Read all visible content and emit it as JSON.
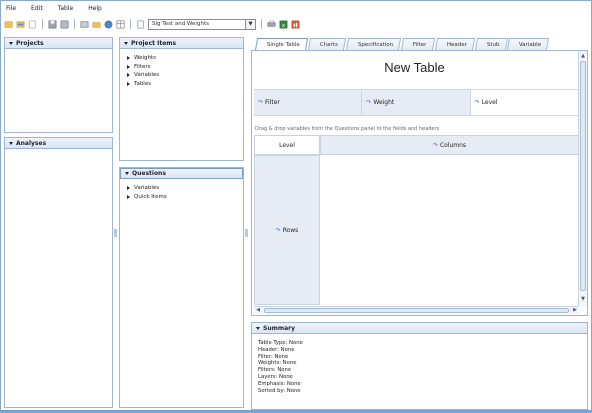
{
  "menu": [
    "File",
    "Edit",
    "Table",
    "Help"
  ],
  "toolbar": {
    "icons": [
      "new-icon",
      "open-icon",
      "doc-icon",
      "save-icon",
      "save-all-icon",
      "print-preview-icon",
      "folder-icon",
      "globe-icon",
      "table-icon",
      "sig-test-icon",
      "print-icon",
      "excel-icon",
      "chart-export-icon"
    ],
    "combo_value": "Sig Test and Weights"
  },
  "panels": {
    "projects": {
      "title": "Projects"
    },
    "analyses": {
      "title": "Analyses"
    },
    "project_items": {
      "title": "Project Items",
      "items": [
        "Weights",
        "Filters",
        "Variables",
        "Tables"
      ]
    },
    "questions": {
      "title": "Questions",
      "items": [
        "Variables",
        "Quick Items"
      ]
    },
    "summary": {
      "title": "Summary",
      "lines": [
        "Table Type: None",
        "Header: None",
        "Filter: None",
        "Weights: None",
        "Filters: None",
        "Layers: None",
        "Emphasis: None",
        "Sorted by: None"
      ]
    }
  },
  "tabs": [
    "Single Table",
    "Charts",
    "Specification",
    "Filter",
    "Header",
    "Stub",
    "Variable"
  ],
  "editor": {
    "title": "New Table",
    "drop_zones": [
      "Filter",
      "Weight",
      "Level"
    ],
    "hint": "Drag & drop variables from the Questions panel to the fields and headers",
    "corner_label": "Level",
    "columns_label": "Columns",
    "rows_label": "Rows"
  },
  "colors": {
    "panel_border": "#9fb6d3",
    "header_fill": "#d9e6f5",
    "zone_fill": "#e6ebf4",
    "accent": "#3a78c4"
  }
}
